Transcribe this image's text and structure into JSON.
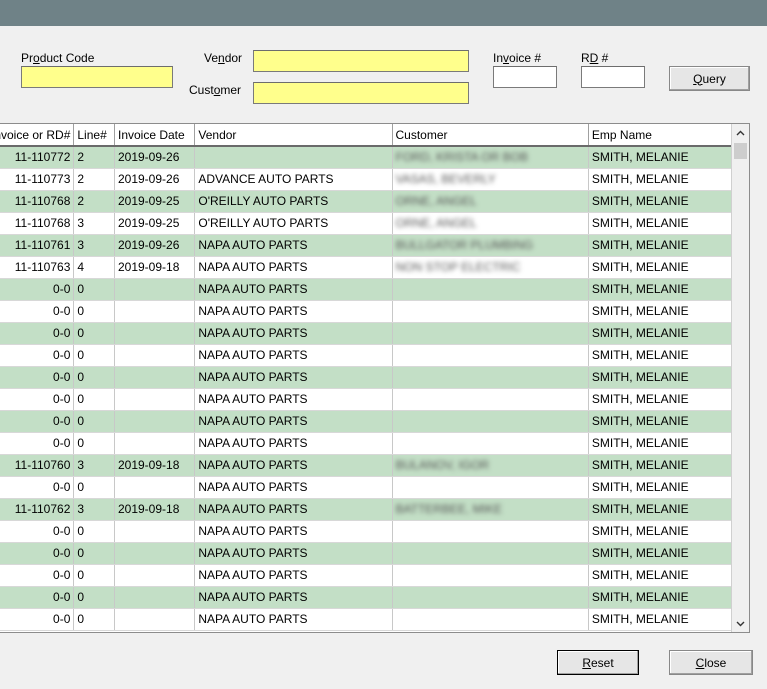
{
  "form": {
    "product_code_label_pre": "Pr",
    "product_code_label_u": "o",
    "product_code_label_post": "duct Code",
    "vendor_label_pre": "Ve",
    "vendor_label_u": "n",
    "vendor_label_post": "dor",
    "customer_label_pre": "Cust",
    "customer_label_u": "o",
    "customer_label_post": "mer",
    "invoice_label_pre": "In",
    "invoice_label_u": "v",
    "invoice_label_post": "oice #",
    "rd_label_pre": "R",
    "rd_label_u": "D",
    "rd_label_post": " #",
    "product_code_value": "",
    "vendor_value": "",
    "customer_value": "",
    "invoice_value": "",
    "rd_value": ""
  },
  "buttons": {
    "query_u": "Q",
    "query_rest": "uery",
    "reset_u": "R",
    "reset_rest": "eset",
    "close_u": "C",
    "close_rest": "lose"
  },
  "colors": {
    "titlebar": "#6f8287",
    "input_highlight": "#ffff8c",
    "row_alt": "#c3dfc6"
  },
  "table": {
    "headers": [
      "Invoice or RD#",
      "Line#",
      "Invoice Date",
      "Vendor",
      "Customer",
      "Emp Name"
    ],
    "rows": [
      {
        "inv": "11-110772",
        "line": "2",
        "date": "2019-09-26",
        "vendor": "",
        "customer": "FORD, KRISTA OR BOB",
        "emp": "SMITH, MELANIE"
      },
      {
        "inv": "11-110773",
        "line": "2",
        "date": "2019-09-26",
        "vendor": "ADVANCE AUTO PARTS",
        "customer": "VASAS, BEVERLY",
        "emp": "SMITH, MELANIE"
      },
      {
        "inv": "11-110768",
        "line": "2",
        "date": "2019-09-25",
        "vendor": "O'REILLY AUTO PARTS",
        "customer": "ORNE, ANGEL",
        "emp": "SMITH, MELANIE"
      },
      {
        "inv": "11-110768",
        "line": "3",
        "date": "2019-09-25",
        "vendor": "O'REILLY AUTO PARTS",
        "customer": "ORNE, ANGEL",
        "emp": "SMITH, MELANIE"
      },
      {
        "inv": "11-110761",
        "line": "3",
        "date": "2019-09-26",
        "vendor": "NAPA AUTO PARTS",
        "customer": "BULLGATOR PLUMBING",
        "emp": "SMITH, MELANIE"
      },
      {
        "inv": "11-110763",
        "line": "4",
        "date": "2019-09-18",
        "vendor": "NAPA AUTO PARTS",
        "customer": "NON STOP ELECTRIC",
        "emp": "SMITH, MELANIE"
      },
      {
        "inv": "0-0",
        "line": "0",
        "date": "",
        "vendor": "NAPA AUTO PARTS",
        "customer": "",
        "emp": "SMITH, MELANIE"
      },
      {
        "inv": "0-0",
        "line": "0",
        "date": "",
        "vendor": "NAPA AUTO PARTS",
        "customer": "",
        "emp": "SMITH, MELANIE"
      },
      {
        "inv": "0-0",
        "line": "0",
        "date": "",
        "vendor": "NAPA AUTO PARTS",
        "customer": "",
        "emp": "SMITH, MELANIE"
      },
      {
        "inv": "0-0",
        "line": "0",
        "date": "",
        "vendor": "NAPA AUTO PARTS",
        "customer": "",
        "emp": "SMITH, MELANIE"
      },
      {
        "inv": "0-0",
        "line": "0",
        "date": "",
        "vendor": "NAPA AUTO PARTS",
        "customer": "",
        "emp": "SMITH, MELANIE"
      },
      {
        "inv": "0-0",
        "line": "0",
        "date": "",
        "vendor": "NAPA AUTO PARTS",
        "customer": "",
        "emp": "SMITH, MELANIE"
      },
      {
        "inv": "0-0",
        "line": "0",
        "date": "",
        "vendor": "NAPA AUTO PARTS",
        "customer": "",
        "emp": "SMITH, MELANIE"
      },
      {
        "inv": "0-0",
        "line": "0",
        "date": "",
        "vendor": "NAPA AUTO PARTS",
        "customer": "",
        "emp": "SMITH, MELANIE"
      },
      {
        "inv": "11-110760",
        "line": "3",
        "date": "2019-09-18",
        "vendor": "NAPA AUTO PARTS",
        "customer": "BULANOV, IGOR",
        "emp": "SMITH, MELANIE"
      },
      {
        "inv": "0-0",
        "line": "0",
        "date": "",
        "vendor": "NAPA AUTO PARTS",
        "customer": "",
        "emp": "SMITH, MELANIE"
      },
      {
        "inv": "11-110762",
        "line": "3",
        "date": "2019-09-18",
        "vendor": "NAPA AUTO PARTS",
        "customer": "BATTERBEE, MIKE",
        "emp": "SMITH, MELANIE"
      },
      {
        "inv": "0-0",
        "line": "0",
        "date": "",
        "vendor": "NAPA AUTO PARTS",
        "customer": "",
        "emp": "SMITH, MELANIE"
      },
      {
        "inv": "0-0",
        "line": "0",
        "date": "",
        "vendor": "NAPA AUTO PARTS",
        "customer": "",
        "emp": "SMITH, MELANIE"
      },
      {
        "inv": "0-0",
        "line": "0",
        "date": "",
        "vendor": "NAPA AUTO PARTS",
        "customer": "",
        "emp": "SMITH, MELANIE"
      },
      {
        "inv": "0-0",
        "line": "0",
        "date": "",
        "vendor": "NAPA AUTO PARTS",
        "customer": "",
        "emp": "SMITH, MELANIE"
      },
      {
        "inv": "0-0",
        "line": "0",
        "date": "",
        "vendor": "NAPA AUTO PARTS",
        "customer": "",
        "emp": "SMITH, MELANIE"
      }
    ]
  },
  "scrollbar": {
    "up_icon": "chevron-up-icon",
    "down_icon": "chevron-down-icon"
  }
}
